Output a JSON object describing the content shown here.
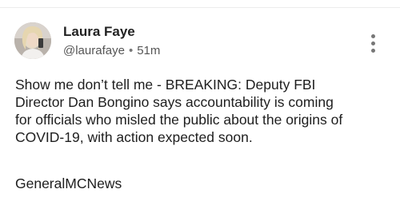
{
  "post": {
    "author": {
      "name": "Laura Faye",
      "handle": "@laurafaye",
      "avatar_icon": "profile-photo"
    },
    "time_ago": "51m",
    "separator": "•",
    "more_icon": "vertical-ellipsis-icon",
    "body": "Show me don’t tell me - BREAKING: Deputy FBI\nDirector Dan Bongino says accountability is coming\nfor officials who misled the public about the origins of\nCOVID-19, with action expected soon.",
    "source": "GeneralMCNews"
  }
}
